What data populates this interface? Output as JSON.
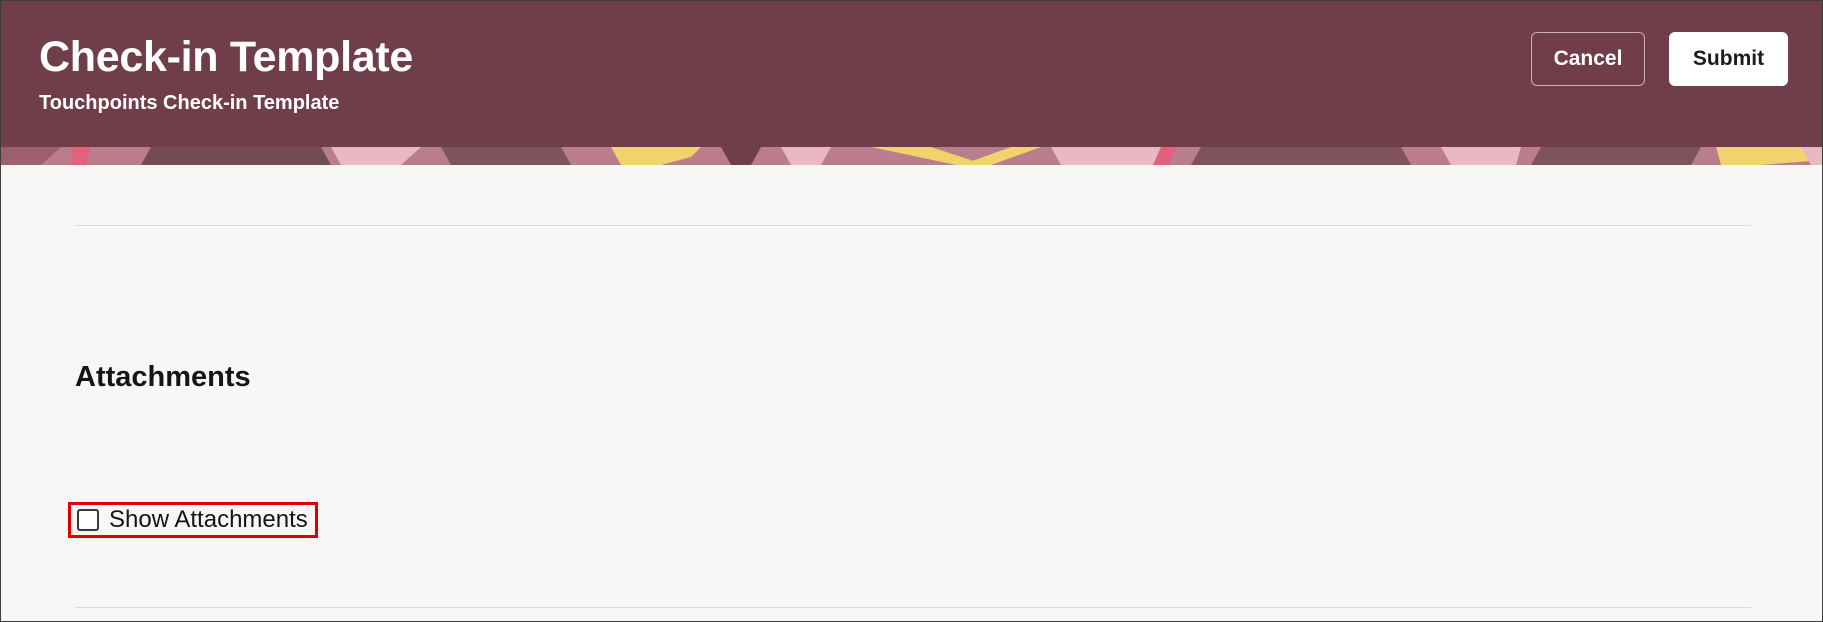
{
  "header": {
    "title": "Check-in Template",
    "subtitle": "Touchpoints Check-in Template",
    "background_color": "#6f3e4a",
    "cancel_label": "Cancel",
    "submit_label": "Submit"
  },
  "banner": {
    "pattern_colors": [
      "#b97d8b",
      "#6f3e4a",
      "#e9b8c3",
      "#f0d36a",
      "#e1607e",
      "#3a2226"
    ]
  },
  "section": {
    "heading": "Attachments"
  },
  "show_attachments": {
    "label": "Show Attachments",
    "checked": false,
    "highlight_color": "#e00000"
  }
}
